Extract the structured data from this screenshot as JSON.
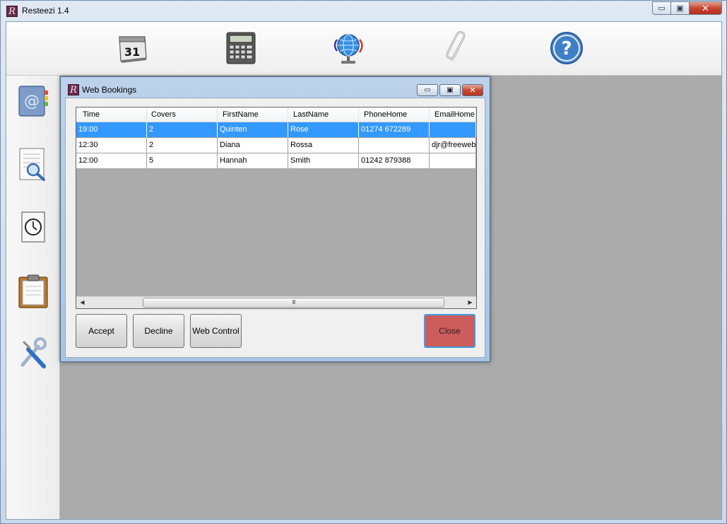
{
  "window": {
    "title": "Resteezi 1.4",
    "min_glyph": "▭",
    "max_glyph": "▣",
    "close_glyph": "✕",
    "icon_letter": "R"
  },
  "toolbar": {
    "items": [
      {
        "name": "calendar-icon",
        "text": "31"
      },
      {
        "name": "calculator-icon"
      },
      {
        "name": "globe-network-icon"
      },
      {
        "name": "paperclip-icon"
      },
      {
        "name": "help-icon",
        "text": "?"
      }
    ]
  },
  "sidebar": {
    "items": [
      {
        "name": "address-book-icon",
        "text": "@"
      },
      {
        "name": "document-search-icon"
      },
      {
        "name": "clock-document-icon"
      },
      {
        "name": "clipboard-icon"
      },
      {
        "name": "tools-icon"
      }
    ]
  },
  "dialog": {
    "title": "Web Bookings",
    "icon_letter": "R",
    "min_glyph": "▭",
    "max_glyph": "▣",
    "close_glyph": "✕",
    "columns": [
      "Time",
      "Covers",
      "FirstName",
      "LastName",
      "PhoneHome",
      "EmailHome"
    ],
    "rows": [
      {
        "selected": true,
        "cells": [
          "19:00",
          "2",
          "Quinten",
          "Rose",
          "01274 672289",
          ""
        ]
      },
      {
        "selected": false,
        "cells": [
          "12:30",
          "2",
          "Diana",
          "Rossa",
          "",
          "djr@freewebr"
        ]
      },
      {
        "selected": false,
        "cells": [
          "12:00",
          "5",
          "Hannah",
          "Smith",
          "01242 879388",
          ""
        ]
      }
    ],
    "scroll": {
      "left_arrow": "◀",
      "right_arrow": "▶",
      "grip": "III"
    },
    "buttons": {
      "accept": "Accept",
      "decline": "Decline",
      "web_control": "Web Control",
      "close": "Close"
    }
  },
  "colors": {
    "selection": "#3399ff",
    "close_button": "#cd5c5c",
    "mdi_background": "#ababab"
  }
}
